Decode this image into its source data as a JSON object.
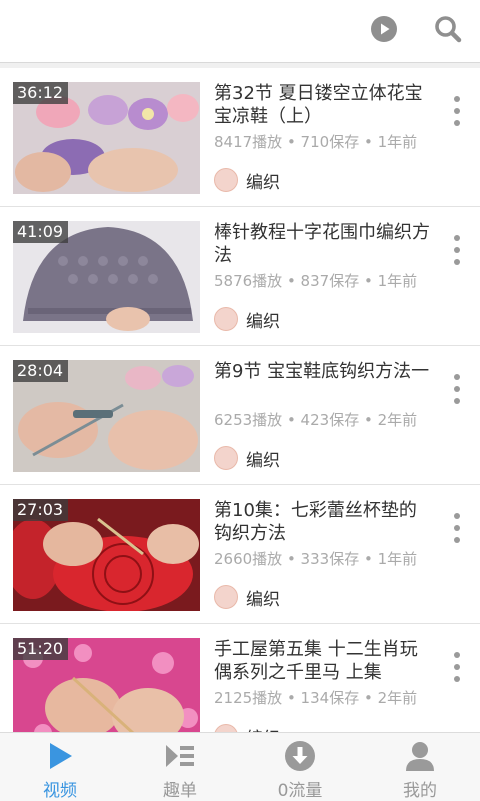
{
  "colors": {
    "accent": "#3a95e0",
    "meta_text": "#aaaaaa",
    "icon_gray": "#9a9a9a"
  },
  "header": {
    "play_icon": "play-circle-icon",
    "search_icon": "search-icon"
  },
  "videos": [
    {
      "duration": "36:12",
      "title": "第32节 夏日镂空立体花宝宝凉鞋（上）",
      "meta": "8417播放 • 710保存 • 1年前",
      "author": "编织"
    },
    {
      "duration": "41:09",
      "title": "棒针教程十字花围巾编织方法",
      "meta": "5876播放 • 837保存 • 1年前",
      "author": "编织"
    },
    {
      "duration": "28:04",
      "title": "第9节 宝宝鞋底钩织方法一",
      "meta": "6253播放 • 423保存 • 2年前",
      "author": "编织"
    },
    {
      "duration": "27:03",
      "title": "第10集：七彩蕾丝杯垫的钩织方法",
      "meta": "2660播放 • 333保存 • 1年前",
      "author": "编织"
    },
    {
      "duration": "51:20",
      "title": "手工屋第五集 十二生肖玩偶系列之千里马 上集",
      "meta": "2125播放 • 134保存 • 2年前",
      "author": "编织"
    }
  ],
  "tabs": [
    {
      "label": "视频",
      "icon": "video-play-icon",
      "active": true
    },
    {
      "label": "趣单",
      "icon": "playlist-icon",
      "active": false
    },
    {
      "label": "0流量",
      "icon": "download-icon",
      "active": false
    },
    {
      "label": "我的",
      "icon": "user-icon",
      "active": false
    }
  ]
}
